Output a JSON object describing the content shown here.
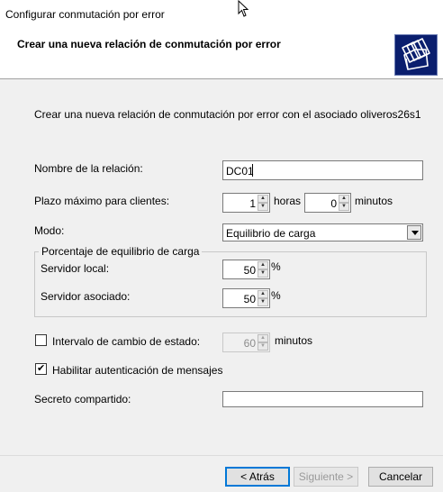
{
  "window": {
    "title": "Configurar conmutación por error"
  },
  "header": {
    "title": "Crear una nueva relación de conmutación por error",
    "icon": "folders-icon",
    "icon_bg": "#0a1e6e"
  },
  "intro": "Crear una nueva relación de conmutación por error con el asociado oliveros26s1",
  "relation_name": {
    "label": "Nombre de la relación:",
    "value": "DC01"
  },
  "max_client_lead_time": {
    "label": "Plazo máximo para clientes:",
    "hours_value": "1",
    "hours_unit": "horas",
    "minutes_value": "0",
    "minutes_unit": "minutos"
  },
  "mode": {
    "label": "Modo:",
    "value": "Equilibrio de carga"
  },
  "load_balance": {
    "legend": "Porcentaje de equilibrio de carga",
    "local_label": "Servidor local:",
    "local_value": "50",
    "partner_label": "Servidor asociado:",
    "partner_value": "50",
    "unit": "%"
  },
  "state_switchover": {
    "label": "Intervalo de cambio de estado:",
    "checked": false,
    "value": "60",
    "unit": "minutos"
  },
  "message_auth": {
    "label": "Habilitar autenticación de mensajes",
    "checked": true
  },
  "shared_secret": {
    "label": "Secreto compartido:",
    "value": ""
  },
  "buttons": {
    "back": "< Atrás",
    "next": "Siguiente >",
    "cancel": "Cancelar"
  },
  "colors": {
    "default_button_border": "#0078d7"
  }
}
